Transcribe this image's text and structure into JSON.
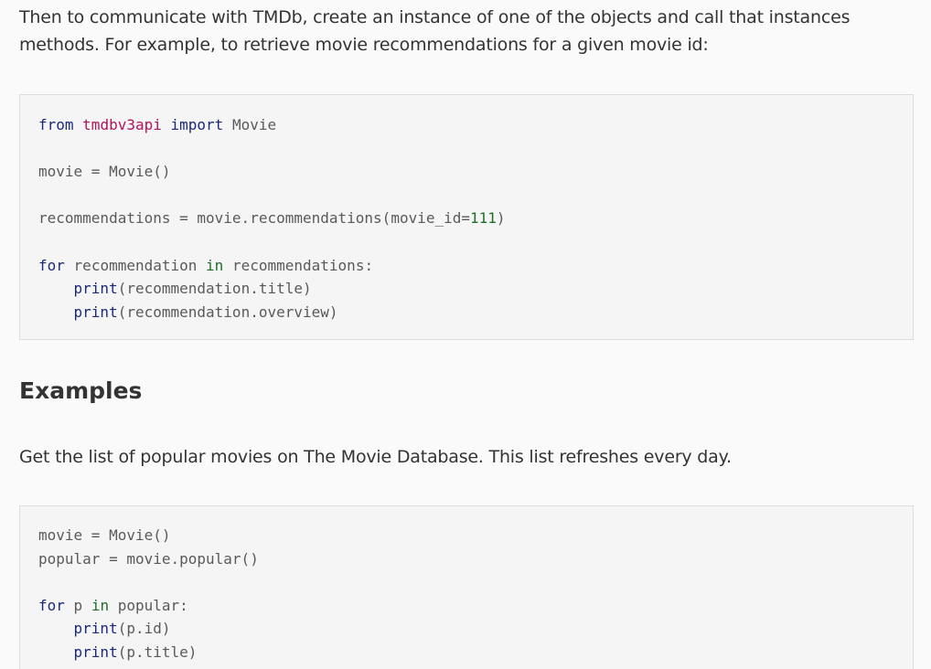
{
  "intro": {
    "text": "Then to communicate with TMDb, create an instance of one of the objects and call that instances methods. For example, to retrieve movie recommendations for a given movie id:"
  },
  "code1": {
    "line1": {
      "kw1": "from",
      "mod": "tmdbv3api",
      "kw2": "import",
      "name": "Movie"
    },
    "line2": {
      "text": "movie = Movie()"
    },
    "line3": {
      "pre": "recommendations = movie.recommendations(movie_id=",
      "num": "111",
      "post": ")"
    },
    "line4": {
      "kw": "for",
      "var": "recommendation",
      "kw_in": "in",
      "rest": "recommendations:"
    },
    "line5": {
      "fn": "print",
      "args": "(recommendation.title)"
    },
    "line6": {
      "fn": "print",
      "args": "(recommendation.overview)"
    }
  },
  "examples": {
    "heading": "Examples",
    "description": "Get the list of popular movies on The Movie Database. This list refreshes every day."
  },
  "code2": {
    "line1": {
      "text": "movie = Movie()"
    },
    "line2": {
      "text": "popular = movie.popular()"
    },
    "line3": {
      "kw": "for",
      "var": "p",
      "kw_in": "in",
      "rest": "popular:"
    },
    "line4": {
      "fn": "print",
      "args": "(p.id)"
    },
    "line5": {
      "fn": "print",
      "args": "(p.title)"
    }
  }
}
